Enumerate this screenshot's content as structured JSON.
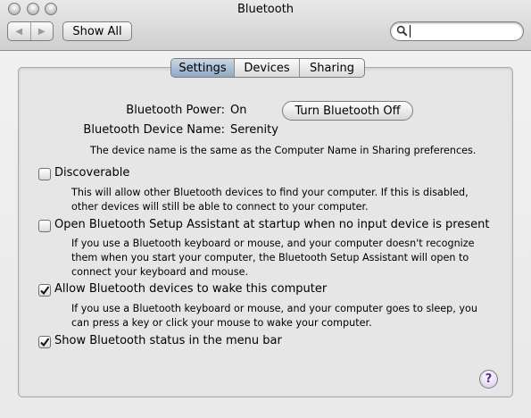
{
  "window": {
    "title": "Bluetooth"
  },
  "toolbar": {
    "back_icon": "back-arrow-icon",
    "forward_icon": "forward-arrow-icon",
    "show_all_label": "Show All",
    "search": {
      "value": "",
      "placeholder": ""
    }
  },
  "tabs": [
    {
      "label": "Settings",
      "selected": true
    },
    {
      "label": "Devices",
      "selected": false
    },
    {
      "label": "Sharing",
      "selected": false
    }
  ],
  "settings": {
    "power_label": "Bluetooth Power:",
    "power_value": "On",
    "turn_off_button": "Turn Bluetooth Off",
    "device_name_label": "Bluetooth Device Name:",
    "device_name_value": "Serenity",
    "device_name_note": "The device name is the same as the Computer Name in Sharing preferences.",
    "options": [
      {
        "label": "Discoverable",
        "checked": false,
        "description": "This will allow other Bluetooth devices to find your computer.  If this is disabled, other devices will still be able to connect to your computer."
      },
      {
        "label": "Open Bluetooth Setup Assistant at startup when no input device is present",
        "checked": false,
        "description": "If you use a Bluetooth keyboard or mouse, and your computer doesn't recognize them when you start your computer, the Bluetooth Setup Assistant will open to connect your keyboard and mouse."
      },
      {
        "label": "Allow Bluetooth devices to wake this computer",
        "checked": true,
        "description": "If you use a Bluetooth keyboard or mouse, and your computer goes to sleep, you can press a key or click your mouse to wake your computer."
      },
      {
        "label": "Show Bluetooth status in the menu bar",
        "checked": true,
        "description": ""
      }
    ]
  },
  "help": {
    "label": "?"
  },
  "colors": {
    "active_tab": "#8fa9c6",
    "help_glyph": "#5a2d95"
  }
}
